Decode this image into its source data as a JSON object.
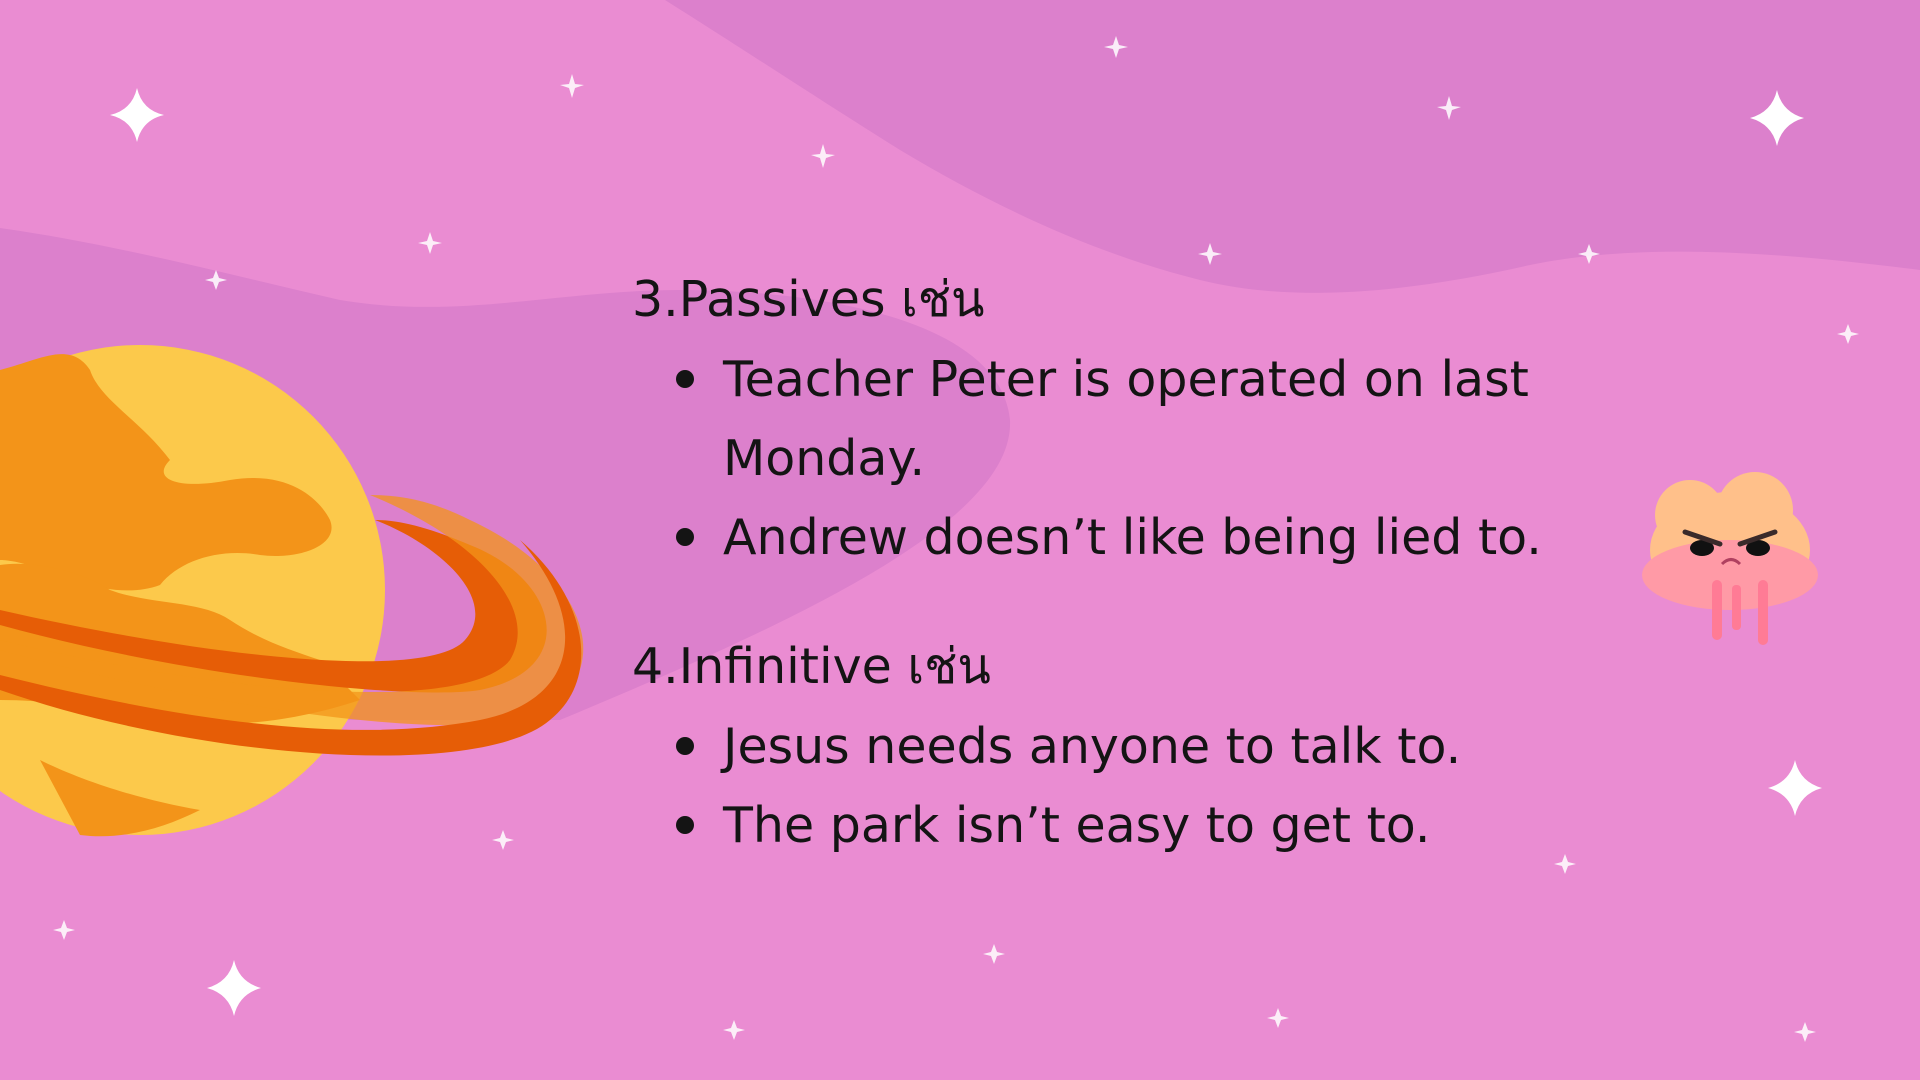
{
  "slide": {
    "sections": [
      {
        "heading": "3.Passives เช่น",
        "items": [
          "Teacher Peter is operated on last Monday.",
          "Andrew doesn’t like being lied to."
        ]
      },
      {
        "heading": "4.Infinitive เช่น",
        "items": [
          "Jesus needs anyone to talk to.",
          "The park isn’t easy to get to."
        ]
      }
    ]
  },
  "colors": {
    "background": "#ea8cd2",
    "background_dark": "#dc80cc",
    "planet_yellow": "#fcc94b",
    "planet_orange": "#f39419",
    "ring_red": "#e65d06",
    "text": "#141414"
  },
  "icons": [
    "sparkle-star-icon",
    "ringed-planet-icon",
    "angry-cloud-icon"
  ]
}
